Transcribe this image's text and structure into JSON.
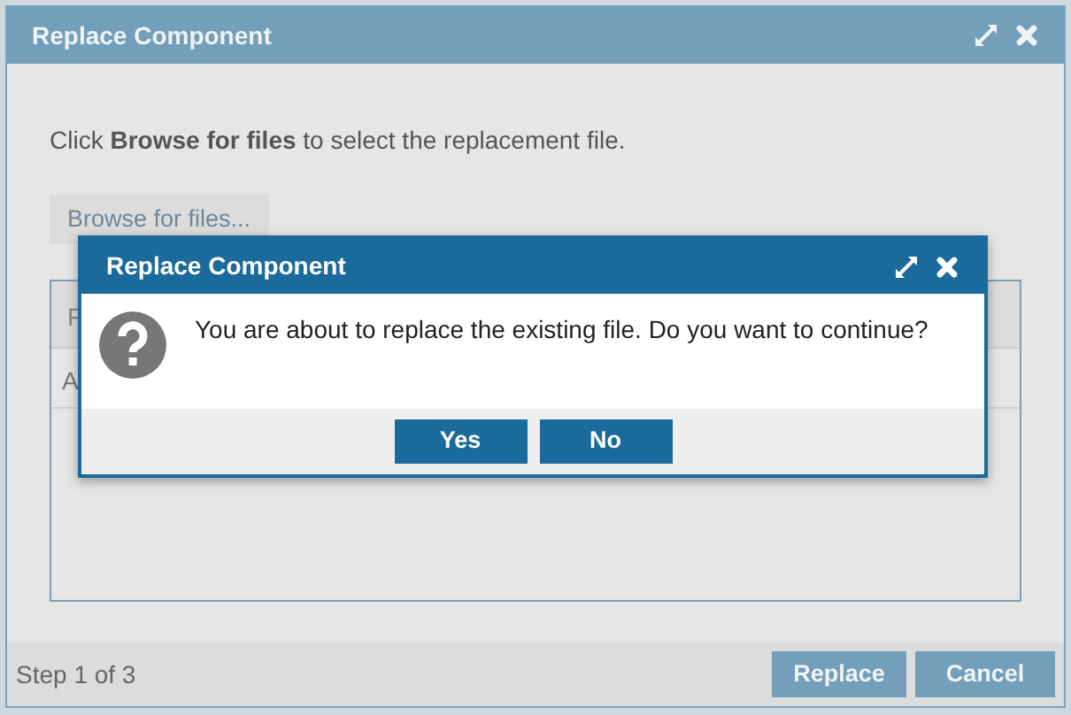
{
  "dialog": {
    "title": "Replace Component",
    "instruction": "Click **Browse for files** to select the replacement file.",
    "browse_button": "Browse for files...",
    "file_table": {
      "column_1": "F",
      "rows": [
        {
          "column_1": "A"
        }
      ]
    },
    "step": "Step 1 of 3",
    "buttons": [
      {
        "label": "Replace"
      },
      {
        "label": "Cancel"
      }
    ]
  },
  "confirm": {
    "title": "Replace Component",
    "message": "You are about to replace the existing file. Do you want to continue?",
    "buttons": [
      "Yes",
      "No"
    ]
  }
}
